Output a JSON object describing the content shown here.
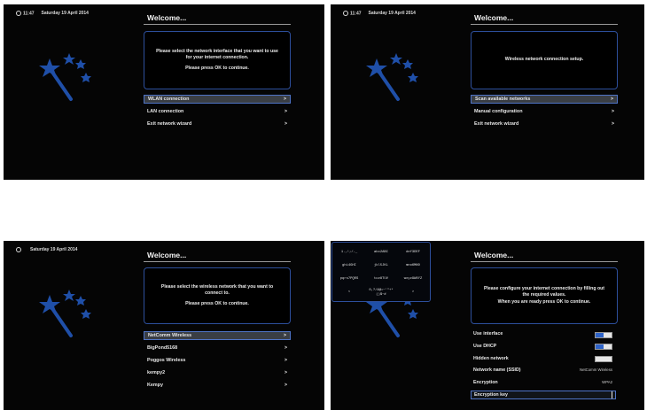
{
  "colors": {
    "background": "#050505",
    "accent": "#2d4f9c",
    "selection": "#4f74c6",
    "star": "#1f4fa8"
  },
  "screen1": {
    "time": "11:47",
    "date": "Saturday 19 April 2014",
    "title": "Welcome...",
    "info_lines": [
      "Please select the network interface that you want to use",
      "for your internet connection.",
      "Please press OK to continue."
    ],
    "menu": [
      {
        "label": "WLAN connection",
        "arrow": ">"
      },
      {
        "label": "LAN connection",
        "arrow": ">"
      },
      {
        "label": "Exit network wizard",
        "arrow": ">"
      }
    ],
    "selected_index": 0
  },
  "screen2": {
    "time": "11:47",
    "date": "Saturday 19 April 2014",
    "title": "Welcome...",
    "info_lines": [
      "Wireless network connection setup."
    ],
    "menu": [
      {
        "label": "Scan available networks",
        "arrow": ">"
      },
      {
        "label": "Manual configuration",
        "arrow": ">"
      },
      {
        "label": "Exit network wizard",
        "arrow": ">"
      }
    ],
    "selected_index": 0
  },
  "screen3": {
    "date": "Saturday 19 April 2014",
    "title": "Welcome...",
    "info_lines": [
      "Please select the wireless network that you want to",
      "connect to.",
      "Please press OK to continue."
    ],
    "menu": [
      {
        "label": "NetComm Wireless",
        "arrow": ">"
      },
      {
        "label": "BigPond5168",
        "arrow": ">"
      },
      {
        "label": "Poggos Wireless",
        "arrow": ">"
      },
      {
        "label": "kempy2",
        "arrow": ">"
      },
      {
        "label": "Kempy",
        "arrow": ">"
      }
    ],
    "selected_index": 0
  },
  "screen4": {
    "title": "Welcome...",
    "info_lines": [
      "Please configure your internet connection by filling out",
      "the required values.",
      "When you are ready press OK to continue."
    ],
    "keyboard": {
      "keys": [
        "1.,!;/-_",
        "abc2ABC",
        "def3DEF",
        "ghi4GHI",
        "jkl5JKL",
        "mno6MNO",
        "pqrs7PQRS",
        "tuv8TUV",
        "wxyz9WXYZ",
        "<",
        "0,?/&@=~'\"+*",
        ">"
      ],
      "key_line2": "()$~#"
    },
    "fields": [
      {
        "label": "Use interface",
        "type": "toggle",
        "on": true
      },
      {
        "label": "Use DHCP",
        "type": "toggle",
        "on": true
      },
      {
        "label": "Hidden network",
        "type": "toggle",
        "on": false
      },
      {
        "label": "Network name (SSID)",
        "type": "text",
        "value": "NetComm Wireless"
      },
      {
        "label": "Encryption",
        "type": "text",
        "value": "WPA2"
      },
      {
        "label": "Encryption key",
        "type": "input",
        "value": ""
      }
    ]
  }
}
